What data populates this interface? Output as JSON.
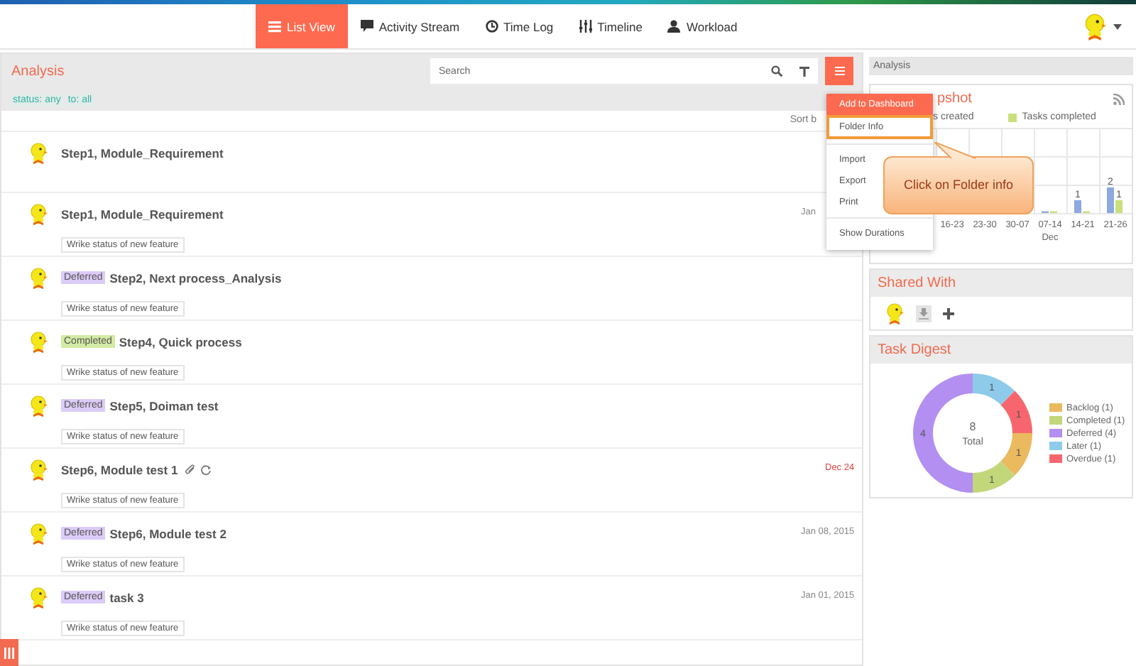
{
  "nav": {
    "tabs": [
      {
        "label": "List View",
        "selected": true
      },
      {
        "label": "Activity Stream",
        "selected": false
      },
      {
        "label": "Time Log",
        "selected": false
      },
      {
        "label": "Timeline",
        "selected": false
      },
      {
        "label": "Workload",
        "selected": false
      }
    ]
  },
  "folder": {
    "title": "Analysis",
    "search": {
      "placeholder": "Search"
    },
    "filters": [
      "status: any",
      "to: all"
    ],
    "sort_label": "Sort b"
  },
  "tasks": [
    {
      "title": "Step1, Module_Requirement",
      "attachment": false,
      "recurring": false
    },
    {
      "title": "Step1, Module_Requirement",
      "description": "Wrike status of new feature",
      "date": "Jan",
      "overdue": false,
      "attachment": false,
      "recurring": false
    },
    {
      "status": {
        "label": "Deferred",
        "color": "#dccbf7"
      },
      "title": "Step2, Next process_Analysis",
      "description": "Wrike status of new feature",
      "attachment": false,
      "recurring": false
    },
    {
      "status": {
        "label": "Completed",
        "color": "#d3eba4"
      },
      "title": "Step4, Quick process",
      "description": "Wrike status of new feature",
      "attachment": false,
      "recurring": false
    },
    {
      "status": {
        "label": "Deferred",
        "color": "#dccbf7"
      },
      "title": "Step5, Doiman test",
      "description": "Wrike status of new feature",
      "attachment": false,
      "recurring": false
    },
    {
      "title": "Step6, Module test 1",
      "description": "Wrike status of new feature",
      "date": "Dec 24",
      "overdue": true,
      "attachment": true,
      "recurring": true
    },
    {
      "status": {
        "label": "Deferred",
        "color": "#dccbf7"
      },
      "title": "Step6, Module test 2",
      "description": "Wrike status of new feature",
      "date": "Jan 08, 2015",
      "overdue": false,
      "attachment": false,
      "recurring": false
    },
    {
      "status": {
        "label": "Deferred",
        "color": "#dccbf7"
      },
      "title": "task 3",
      "description": "Wrike status of new feature",
      "date": "Jan 01, 2015",
      "overdue": false,
      "attachment": false,
      "recurring": false
    }
  ],
  "menu": {
    "items": [
      {
        "label": "Add to Dashboard",
        "selected": true,
        "outlined": false,
        "separator_before": false
      },
      {
        "label": "Folder Info",
        "selected": false,
        "outlined": true,
        "separator_before": false
      },
      {
        "label": "Import",
        "selected": false,
        "outlined": false,
        "separator_before": true
      },
      {
        "label": "Export",
        "selected": false,
        "outlined": false,
        "separator_before": false
      },
      {
        "label": "Print",
        "selected": false,
        "outlined": false,
        "separator_before": false
      },
      {
        "label": "Show Durations",
        "selected": false,
        "outlined": false,
        "separator_before": true
      }
    ]
  },
  "callout": {
    "text": "Click on Folder info"
  },
  "side": {
    "breadcrumb": "Analysis",
    "snapshot": {
      "title": "pshot",
      "month_label": "Dec",
      "chart_data": {
        "type": "bar",
        "categories": [
          "16-23",
          "23-30",
          "30-07",
          "07-14",
          "14-21",
          "21-26"
        ],
        "series": [
          {
            "name": "s created",
            "color": "#8ea8e0",
            "values": [
              0,
              0,
              0,
              0,
              1,
              2
            ],
            "value_labels": [
              null,
              null,
              null,
              null,
              "1",
              "2"
            ]
          },
          {
            "name": "Tasks completed",
            "color": "#c9df7b",
            "values": [
              0,
              0,
              0,
              0,
              0,
              1
            ],
            "value_labels": [
              null,
              null,
              null,
              null,
              null,
              "1"
            ]
          }
        ]
      }
    },
    "shared_with": {
      "title": "Shared With"
    },
    "task_digest": {
      "title": "Task Digest",
      "center_value": "8",
      "center_label": "Total",
      "chart_data": {
        "type": "donut",
        "values": [
          1,
          1,
          4,
          1,
          1
        ],
        "data_labels": true
      },
      "legend": [
        {
          "label": "Backlog (1)",
          "color": "#ebb95e"
        },
        {
          "label": "Completed (1)",
          "color": "#c2d77a"
        },
        {
          "label": "Deferred (4)",
          "color": "#b28ff0"
        },
        {
          "label": "Later (1)",
          "color": "#8ecbea"
        },
        {
          "label": "Overdue (1)",
          "color": "#f7666e"
        }
      ]
    }
  }
}
